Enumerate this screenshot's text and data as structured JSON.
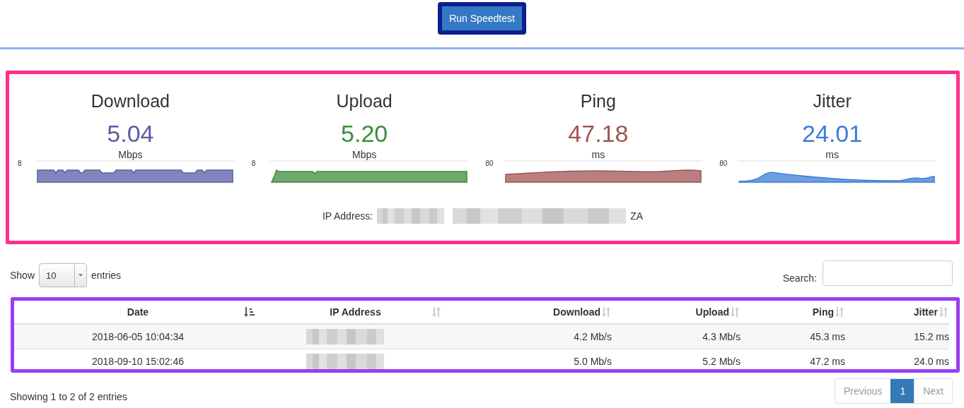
{
  "run_button": {
    "label": "Run Speedtest"
  },
  "meters": [
    {
      "title": "Download",
      "value": "5.04",
      "unit": "Mbps",
      "color": "#5b5ba6",
      "scale_max": "8",
      "kind": "dips"
    },
    {
      "title": "Upload",
      "value": "5.20",
      "unit": "Mbps",
      "color": "#3c8c3c",
      "scale_max": "8",
      "kind": "rise"
    },
    {
      "title": "Ping",
      "value": "47.18",
      "unit": "ms",
      "color": "#a05454",
      "scale_max": "80",
      "kind": "gentle"
    },
    {
      "title": "Jitter",
      "value": "24.01",
      "unit": "ms",
      "color": "#3b7dd8",
      "scale_max": "80",
      "kind": "wave"
    }
  ],
  "ip_address": {
    "label": "IP Address:",
    "redacted": true,
    "country": "ZA"
  },
  "length_menu": {
    "before": "Show",
    "value": "10",
    "after": "entries"
  },
  "search": {
    "label": "Search:"
  },
  "table": {
    "columns": [
      {
        "label": "Date",
        "sorted": true
      },
      {
        "label": "IP Address",
        "sorted": false
      },
      {
        "label": "Download",
        "sorted": false
      },
      {
        "label": "Upload",
        "sorted": false
      },
      {
        "label": "Ping",
        "sorted": false
      },
      {
        "label": "Jitter",
        "sorted": false
      }
    ],
    "rows": [
      {
        "date": "2018-06-05 10:04:34",
        "ip_redacted": true,
        "download": "4.2 Mb/s",
        "upload": "4.3 Mb/s",
        "ping": "45.3 ms",
        "jitter": "15.2 ms"
      },
      {
        "date": "2018-09-10 15:02:46",
        "ip_redacted": true,
        "download": "5.0 Mb/s",
        "upload": "5.2 Mb/s",
        "ping": "47.2 ms",
        "jitter": "24.0 ms"
      }
    ]
  },
  "info": "Showing 1 to 2 of 2 entries",
  "pagination": [
    {
      "label": "Previous",
      "selected": false,
      "disabled": true
    },
    {
      "label": "1",
      "selected": true,
      "disabled": false
    },
    {
      "label": "Next",
      "selected": false,
      "disabled": true
    }
  ]
}
